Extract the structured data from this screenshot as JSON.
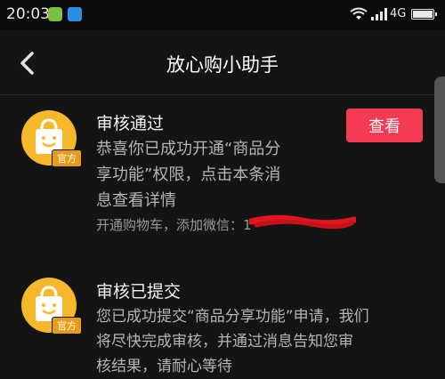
{
  "status_bar": {
    "time": "20:03",
    "network": "4G",
    "icons": [
      "app-icon-green",
      "app-icon-blue",
      "wifi-icon",
      "signal-icon",
      "battery-icon"
    ]
  },
  "nav": {
    "title": "放心购小助手",
    "back_icon": "chevron-left-icon"
  },
  "messages": [
    {
      "avatar_badge": "官方",
      "title": "审核通过",
      "body_lines": [
        "恭喜你已成功开通“商品分",
        "享功能”权限，点击本条消",
        "息查看详情"
      ],
      "sub": "开通购物车，添加微信：1",
      "action_label": "查看"
    },
    {
      "avatar_badge": "官方",
      "title": "审核已提交",
      "body_lines": [
        "您已成功提交“商品分享功能”申请，我们",
        "将尽快完成审核，并通过消息告知您审",
        "核结果，请耐心等待"
      ]
    }
  ],
  "colors": {
    "background": "#141414",
    "accent_button": "#f33a52",
    "avatar": "#f6b82a"
  }
}
